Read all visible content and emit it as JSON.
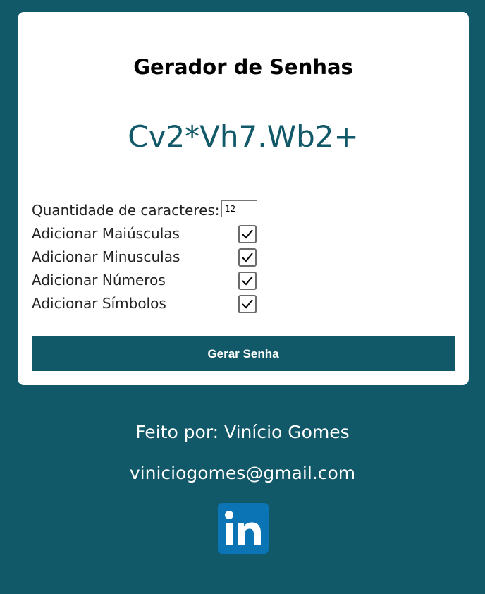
{
  "card": {
    "title": "Gerador de Senhas",
    "password": "Cv2*Vh7.Wb2+",
    "quantity_label": "Quantidade de caracteres:",
    "quantity_value": "12",
    "options": [
      {
        "label": "Adicionar Maiúsculas",
        "checked": true
      },
      {
        "label": "Adicionar Minusculas",
        "checked": true
      },
      {
        "label": "Adicionar Números",
        "checked": true
      },
      {
        "label": "Adicionar Símbolos",
        "checked": true
      }
    ],
    "generate_label": "Gerar Senha"
  },
  "footer": {
    "author": "Feito por: Vinício Gomes",
    "email": "viniciogomes@gmail.com",
    "social_icon": "linkedin-icon"
  },
  "colors": {
    "background": "#115868",
    "accent": "#115868",
    "card": "#ffffff",
    "linkedin": "#0a74b4"
  }
}
